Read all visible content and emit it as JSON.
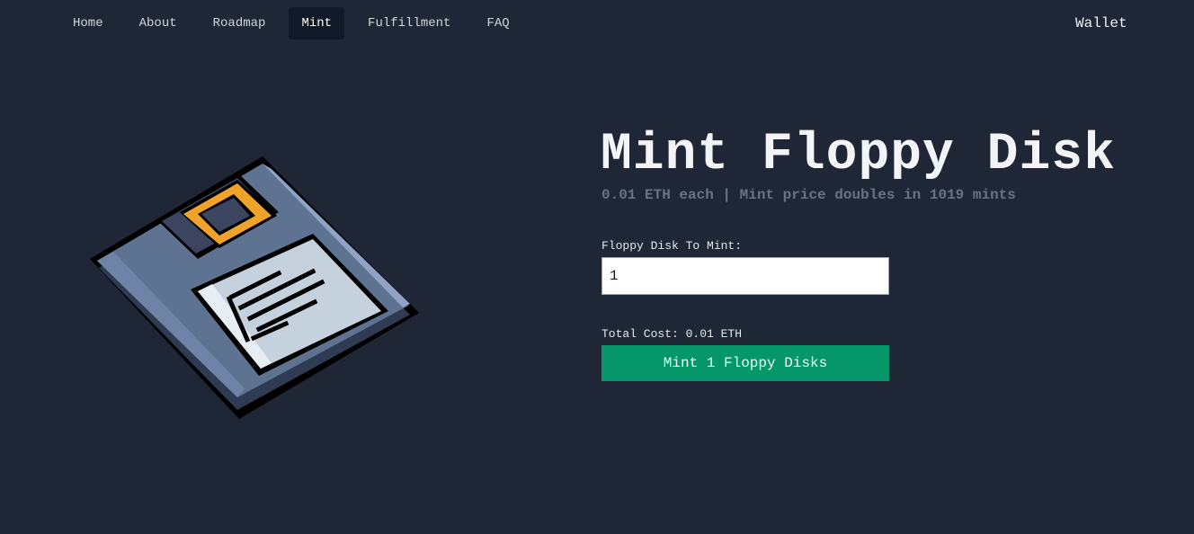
{
  "nav": {
    "items": [
      {
        "label": "Home"
      },
      {
        "label": "About"
      },
      {
        "label": "Roadmap"
      },
      {
        "label": "Mint"
      },
      {
        "label": "Fulfillment"
      },
      {
        "label": "FAQ"
      }
    ],
    "active": "Mint",
    "wallet_label": "Wallet"
  },
  "main": {
    "title": "Mint Floppy Disk",
    "subtitle": "0.01 ETH each | Mint price doubles in 1019 mints",
    "quantity_label": "Floppy Disk To Mint:",
    "quantity_value": "1",
    "total_cost": "Total Cost: 0.01 ETH",
    "mint_button_label": "Mint 1 Floppy Disks"
  },
  "image": {
    "icon": "floppy-disk-pixel-art",
    "colors": {
      "body": "#5e7392",
      "body_dark": "#2e3b52",
      "outline": "#000000",
      "shutter": "#f0a22a",
      "label": "#c5d2dd"
    }
  },
  "colors": {
    "background": "#1f2736",
    "accent": "#059669",
    "nav_active_bg": "#111827"
  }
}
